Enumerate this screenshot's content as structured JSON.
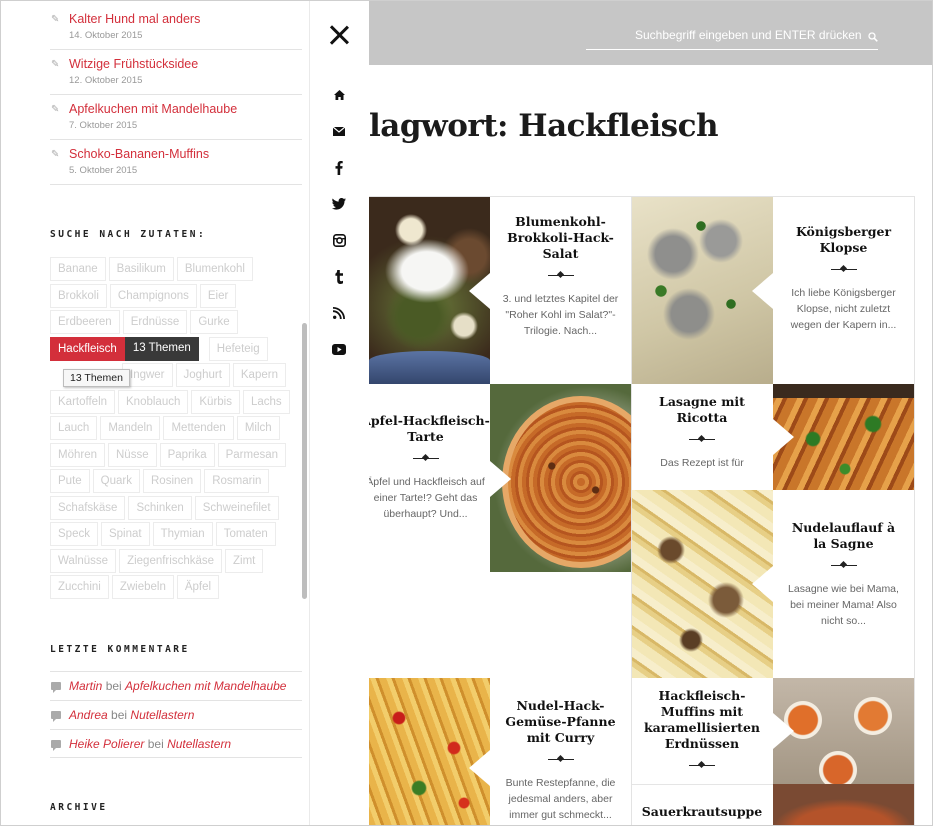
{
  "recent_posts": [
    {
      "title": "Kalter Hund mal anders",
      "date": "14. Oktober 2015"
    },
    {
      "title": "Witzige Frühstücksidee",
      "date": "12. Oktober 2015"
    },
    {
      "title": "Apfelkuchen mit Mandelhaube",
      "date": "7. Oktober 2015"
    },
    {
      "title": "Schoko-Bananen-Muffins",
      "date": "5. Oktober 2015"
    }
  ],
  "tag_widget": {
    "title": "SUCHE NACH ZUTATEN:",
    "rows": [
      [
        "Banane",
        "Basilikum",
        "Blumenkohl"
      ],
      [
        "Brokkoli",
        "Champignons",
        "Eier"
      ],
      [
        "Erdbeeren",
        "Erdnüsse",
        "Gurke"
      ],
      [
        "Hackfleisch",
        "Hefeteig"
      ],
      [
        "Ingwer",
        "Joghurt",
        "Kapern"
      ],
      [
        "Kartoffeln",
        "Knoblauch",
        "Kürbis",
        "Lachs"
      ],
      [
        "Lauch",
        "Mandeln",
        "Mettenden",
        "Milch"
      ],
      [
        "Möhren",
        "Nüsse",
        "Paprika",
        "Parmesan"
      ],
      [
        "Pute",
        "Quark",
        "Rosinen",
        "Rosmarin"
      ],
      [
        "Schafskäse",
        "Schinken",
        "Schweinefilet"
      ],
      [
        "Speck",
        "Spinat",
        "Thymian",
        "Tomaten"
      ],
      [
        "Walnüsse",
        "Ziegenfrischkäse",
        "Zimt"
      ],
      [
        "Zucchini",
        "Zwiebeln",
        "Äpfel"
      ]
    ],
    "active_tag": "Hackfleisch",
    "active_count": "13 Themen",
    "tooltip": "13 Themen"
  },
  "comments_widget": {
    "title": "LETZTE KOMMENTARE",
    "joiner": "bei",
    "items": [
      {
        "author": "Martin",
        "post": "Apfelkuchen mit Mandelhaube"
      },
      {
        "author": "Andrea",
        "post": "Nutellastern"
      },
      {
        "author": "Heike Polierer",
        "post": "Nutellastern"
      }
    ]
  },
  "archive_widget": {
    "title": "ARCHIVE"
  },
  "social_icons": [
    "home-icon",
    "mail-icon",
    "facebook-icon",
    "twitter-icon",
    "instagram-icon",
    "tumblr-icon",
    "rss-icon",
    "youtube-icon"
  ],
  "search": {
    "placeholder": "Suchbegriff eingeben und ENTER drücken"
  },
  "page_title": "lagwort: Hackfleisch",
  "cards": [
    {
      "title": "Blumenkohl-Brokkoli-Hack-Salat",
      "excerpt": "3. und letztes Kapitel der \"Roher Kohl im Salat?\"-Trilogie. Nach..."
    },
    {
      "title": "Königsberger Klopse",
      "excerpt": "Ich liebe Königsberger Klopse, nicht zuletzt wegen der Kapern in..."
    },
    {
      "title": "Apfel-Hackfleisch-Tarte",
      "excerpt": "Äpfel und Hackfleisch auf einer Tarte!? Geht das überhaupt? Und..."
    },
    {
      "title": "Lasagne mit Ricotta",
      "excerpt": "Das Rezept ist für"
    },
    {
      "title": "Nudelauflauf à la Sagne",
      "excerpt": "Lasagne wie bei Mama, bei meiner Mama! Also nicht so..."
    },
    {
      "title": "Nudel-Hack-Gemüse-Pfanne mit Curry",
      "excerpt": "Bunte Restepfanne, die jedesmal anders, aber immer gut schmeckt..."
    },
    {
      "title": "Hackfleisch-Muffins mit karamellisierten Erdnüssen",
      "excerpt": ""
    },
    {
      "title": "Sauerkrautsuppe",
      "excerpt": ""
    }
  ],
  "colors": {
    "accent": "#d32f3b",
    "dark": "#393939",
    "topbar": "#c6c6c6"
  }
}
